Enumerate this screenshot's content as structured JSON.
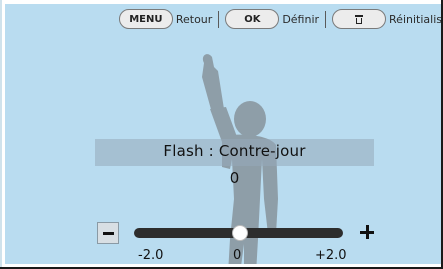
{
  "guide": {
    "menu_key": "MENU",
    "menu_label": "Retour",
    "ok_key": "OK",
    "ok_label": "Définir",
    "trash_icon": "trash-icon",
    "reset_label": "Réinitialis"
  },
  "setting": {
    "title": "Flash : Contre-jour",
    "value": "0"
  },
  "slider": {
    "min_label": "-2.0",
    "mid_label": "0",
    "max_label": "+2.0",
    "value": 0,
    "min": -2.0,
    "max": 2.0,
    "minus_icon": "minus-icon",
    "plus_icon": "plus-icon"
  },
  "colors": {
    "background": "#b9dcf0",
    "silhouette": "#8e9ea8",
    "track": "#2d2d2d",
    "knob": "#ffffff"
  }
}
